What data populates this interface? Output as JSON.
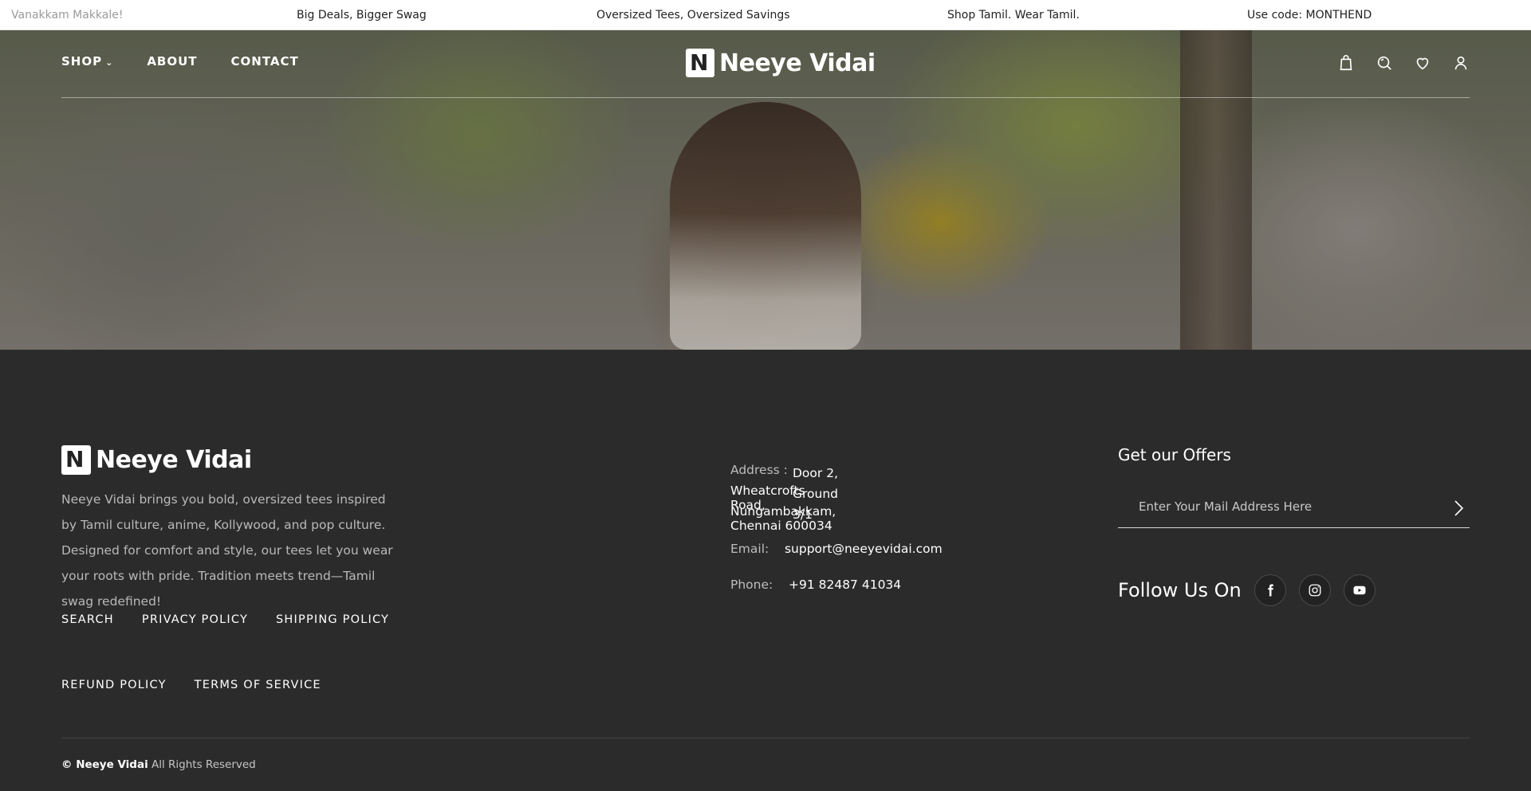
{
  "announcements": [
    "Vanakkam Makkale!",
    "Big Deals, Bigger Swag",
    "Oversized Tees, Oversized Savings",
    "Shop Tamil. Wear Tamil.",
    "Use code: MONTHEND"
  ],
  "header": {
    "nav": {
      "shop": "SHOP",
      "about": "ABOUT",
      "contact": "CONTACT"
    },
    "logo_text": "Neeye Vidai",
    "icons": [
      "bag-icon",
      "search-icon",
      "heart-icon",
      "user-icon"
    ]
  },
  "footer": {
    "logo_text": "Neeye Vidai",
    "description": "Neeye Vidai brings you bold, oversized tees inspired by Tamil culture, anime, Kollywood, and pop culture. Designed for comfort and style, our tees let you wear your roots with pride. Tradition meets trend—Tamil swag redefined!",
    "links_row1": [
      "SEARCH",
      "PRIVACY POLICY",
      "SHIPPING POLICY"
    ],
    "links_row2": [
      "REFUND POLICY",
      "TERMS OF SERVICE"
    ],
    "contact": {
      "address_label": "Address :",
      "address_line1": "Door 2, Ground 3/1",
      "address_line2": "Wheatcrofts Road,",
      "address_line3": "Nungambakkam, Chennai 600034",
      "email_label": "Email:",
      "email": "support@neeyevidai.com",
      "phone_label": "Phone:",
      "phone": "+91 82487 41034"
    },
    "offers": {
      "title": "Get our Offers",
      "placeholder": "Enter Your Mail Address Here"
    },
    "follow_label": "Follow Us On",
    "social": [
      "facebook-icon",
      "instagram-icon",
      "youtube-icon"
    ],
    "copyright_brand": "© Neeye Vidai",
    "copyright_rest": "All Rights Reserved"
  }
}
